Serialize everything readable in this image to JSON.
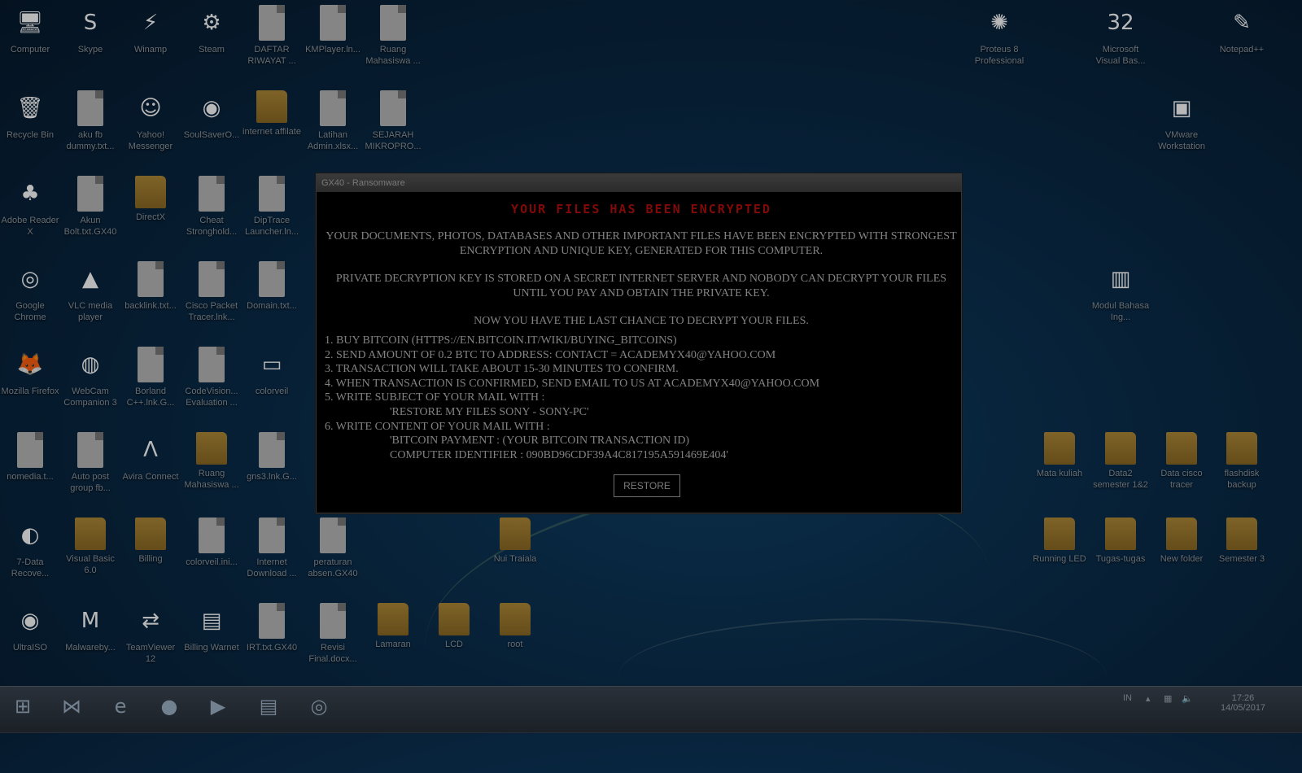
{
  "desktop": {
    "icons": [
      {
        "label": "Computer",
        "glyph": "🖥",
        "kind": "app"
      },
      {
        "label": "Skype",
        "glyph": "S",
        "kind": "app"
      },
      {
        "label": "Winamp",
        "glyph": "⚡",
        "kind": "app"
      },
      {
        "label": "Steam",
        "glyph": "⚙",
        "kind": "app"
      },
      {
        "label": "DAFTAR RIWAYAT ...",
        "glyph": "",
        "kind": "file"
      },
      {
        "label": "KMPlayer.ln...",
        "glyph": "",
        "kind": "file"
      },
      {
        "label": "Ruang Mahasiswa ...",
        "glyph": "",
        "kind": "file"
      },
      {
        "label": "Recycle Bin",
        "glyph": "🗑",
        "kind": "app"
      },
      {
        "label": "aku fb dummy.txt...",
        "glyph": "",
        "kind": "file"
      },
      {
        "label": "Yahoo! Messenger",
        "glyph": "☺",
        "kind": "app"
      },
      {
        "label": "SoulSaverO...",
        "glyph": "◉",
        "kind": "app"
      },
      {
        "label": "internet affilate",
        "glyph": "",
        "kind": "folder"
      },
      {
        "label": "Latihan Admin.xlsx...",
        "glyph": "",
        "kind": "file"
      },
      {
        "label": "SEJARAH MIKROPRO...",
        "glyph": "",
        "kind": "file"
      },
      {
        "label": "Adobe Reader X",
        "glyph": "♣",
        "kind": "app"
      },
      {
        "label": "Akun Bolt.txt.GX40",
        "glyph": "",
        "kind": "file"
      },
      {
        "label": "DirectX",
        "glyph": "",
        "kind": "folder"
      },
      {
        "label": "Cheat Stronghold...",
        "glyph": "",
        "kind": "file"
      },
      {
        "label": "DipTrace Launcher.ln...",
        "glyph": "",
        "kind": "file"
      },
      {
        "label": "Google Chrome",
        "glyph": "◎",
        "kind": "app"
      },
      {
        "label": "VLC media player",
        "glyph": "▲",
        "kind": "app"
      },
      {
        "label": "backlink.txt...",
        "glyph": "",
        "kind": "file"
      },
      {
        "label": "Cisco Packet Tracer.lnk...",
        "glyph": "",
        "kind": "file"
      },
      {
        "label": "Domain.txt...",
        "glyph": "",
        "kind": "file"
      },
      {
        "label": "Mozilla Firefox",
        "glyph": "🦊",
        "kind": "app"
      },
      {
        "label": "WebCam Companion 3",
        "glyph": "◍",
        "kind": "app"
      },
      {
        "label": "Borland C++.lnk.G...",
        "glyph": "",
        "kind": "file"
      },
      {
        "label": "CodeVision... Evaluation ...",
        "glyph": "",
        "kind": "file"
      },
      {
        "label": "colorveil",
        "glyph": "▭",
        "kind": "app"
      },
      {
        "label": "nomedia.t...",
        "glyph": "",
        "kind": "file"
      },
      {
        "label": "Auto post group fb...",
        "glyph": "",
        "kind": "file"
      },
      {
        "label": "Avira Connect",
        "glyph": "Λ",
        "kind": "app"
      },
      {
        "label": "Ruang Mahasiswa ...",
        "glyph": "",
        "kind": "folder"
      },
      {
        "label": "gns3.lnk.G...",
        "glyph": "",
        "kind": "file"
      },
      {
        "label": "7-Data Recove...",
        "glyph": "◐",
        "kind": "app"
      },
      {
        "label": "Visual Basic 6.0",
        "glyph": "",
        "kind": "folder"
      },
      {
        "label": "Billing",
        "glyph": "",
        "kind": "folder"
      },
      {
        "label": "colorveil.ini...",
        "glyph": "",
        "kind": "file"
      },
      {
        "label": "Internet Download ...",
        "glyph": "",
        "kind": "file"
      },
      {
        "label": "peraturan absen.GX40",
        "glyph": "",
        "kind": "file"
      },
      {
        "label": "Nui Traiala",
        "glyph": "",
        "kind": "folder"
      },
      {
        "label": "UltraISO",
        "glyph": "◉",
        "kind": "app"
      },
      {
        "label": "Malwareby...",
        "glyph": "M",
        "kind": "app"
      },
      {
        "label": "TeamViewer 12",
        "glyph": "⇄",
        "kind": "app"
      },
      {
        "label": "Billing Warnet",
        "glyph": "▤",
        "kind": "app"
      },
      {
        "label": "IRT.txt.GX40",
        "glyph": "",
        "kind": "file"
      },
      {
        "label": "Revisi Final.docx...",
        "glyph": "",
        "kind": "file"
      },
      {
        "label": "Lamaran",
        "glyph": "",
        "kind": "folder"
      },
      {
        "label": "LCD",
        "glyph": "",
        "kind": "folder"
      },
      {
        "label": "root",
        "glyph": "",
        "kind": "folder"
      },
      {
        "label": "Proteus 8 Professional",
        "glyph": "✺",
        "kind": "app"
      },
      {
        "label": "Microsoft Visual Bas...",
        "glyph": "32",
        "kind": "app"
      },
      {
        "label": "Notepad++",
        "glyph": "✎",
        "kind": "app"
      },
      {
        "label": "VMware Workstation",
        "glyph": "▣",
        "kind": "app"
      },
      {
        "label": "Modul Bahasa Ing...",
        "glyph": "▥",
        "kind": "app"
      },
      {
        "label": "Mata kuliah",
        "glyph": "",
        "kind": "folder"
      },
      {
        "label": "Data2 semester 1&2",
        "glyph": "",
        "kind": "folder"
      },
      {
        "label": "Data cisco tracer",
        "glyph": "",
        "kind": "folder"
      },
      {
        "label": "flashdisk backup",
        "glyph": "",
        "kind": "folder"
      },
      {
        "label": "Running LED",
        "glyph": "",
        "kind": "folder"
      },
      {
        "label": "Tugas-tugas",
        "glyph": "",
        "kind": "folder"
      },
      {
        "label": "New folder",
        "glyph": "",
        "kind": "folder"
      },
      {
        "label": "Semester 3",
        "glyph": "",
        "kind": "folder"
      }
    ]
  },
  "ransom_window": {
    "title": "GX40 - Ransomware",
    "heading": "YOUR FILES HAS BEEN ENCRYPTED",
    "paragraph1": "YOUR DOCUMENTS, PHOTOS, DATABASES AND OTHER IMPORTANT FILES HAVE BEEN ENCRYPTED WITH STRONGEST ENCRYPTION AND UNIQUE KEY, GENERATED FOR THIS COMPUTER.",
    "paragraph2": "PRIVATE DECRYPTION KEY IS STORED ON A SECRET INTERNET SERVER AND NOBODY CAN DECRYPT YOUR FILES UNTIL YOU PAY AND OBTAIN THE PRIVATE KEY.",
    "paragraph3": "NOW YOU HAVE THE LAST CHANCE TO DECRYPT YOUR FILES.",
    "step1": "1. BUY BITCOIN (HTTPS://EN.BITCOIN.IT/WIKI/BUYING_BITCOINS)",
    "step2": "2. SEND AMOUNT OF 0.2 BTC TO ADDRESS: CONTACT = ACADEMYX40@YAHOO.COM",
    "step3": "3. TRANSACTION WILL TAKE ABOUT 15-30 MINUTES TO CONFIRM.",
    "step4": "4. WHEN TRANSACTION IS CONFIRMED, SEND EMAIL TO US AT ACADEMYX40@YAHOO.COM",
    "step5": "5. WRITE SUBJECT OF YOUR MAIL WITH :",
    "step5_value": "'RESTORE MY FILES SONY - SONY-PC'",
    "step6": "6. WRITE CONTENT OF YOUR MAIL WITH :",
    "step6_value1": "'BITCOIN PAYMENT : (YOUR BITCOIN TRANSACTION ID)",
    "step6_value2": "COMPUTER IDENTIFIER : 090BD96CDF39A4C817195A591469E404'",
    "restore_button": "RESTORE"
  },
  "taskbar": {
    "pinned": [
      {
        "name": "start-button",
        "glyph": "⊞"
      },
      {
        "name": "visual-studio",
        "glyph": "⋈"
      },
      {
        "name": "internet-explorer",
        "glyph": "e"
      },
      {
        "name": "firefox",
        "glyph": "●"
      },
      {
        "name": "media-player",
        "glyph": "▶"
      },
      {
        "name": "explorer",
        "glyph": "▤"
      },
      {
        "name": "chrome",
        "glyph": "◎"
      }
    ],
    "language": "IN",
    "time": "17:26",
    "date": "14/05/2017"
  }
}
